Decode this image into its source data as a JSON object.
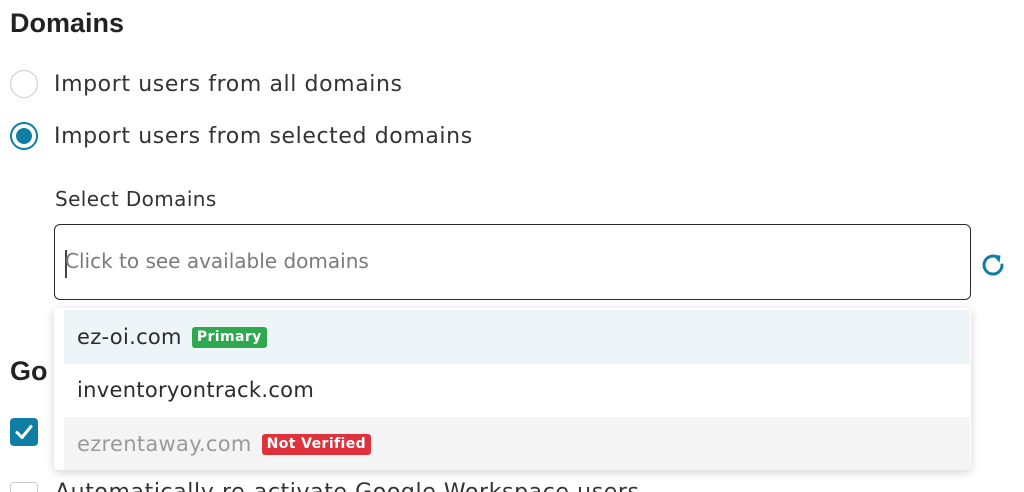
{
  "domains_section": {
    "title": "Domains",
    "options": [
      {
        "label": "Import users from all domains",
        "selected": false
      },
      {
        "label": "Import users from selected domains",
        "selected": true
      }
    ],
    "select_label": "Select Domains",
    "select_placeholder": "Click to see available domains",
    "refresh_icon": "refresh-icon",
    "dropdown_items": [
      {
        "domain": "ez-oi.com",
        "badge": "Primary",
        "badge_color": "#2fa84f",
        "state": "highlighted"
      },
      {
        "domain": "inventoryontrack.com",
        "badge": "",
        "state": "normal"
      },
      {
        "domain": "ezrentaway.com",
        "badge": "Not Verified",
        "badge_color": "#e0323d",
        "state": "disabled"
      }
    ]
  },
  "google_section": {
    "title_partial": "Go",
    "checkbox_checked": true,
    "second_option_partial": "Automatically re-activate Google Workspace users"
  },
  "colors": {
    "accent": "#0e7fa3",
    "primary_badge": "#2fa84f",
    "not_verified_badge": "#e0323d"
  }
}
